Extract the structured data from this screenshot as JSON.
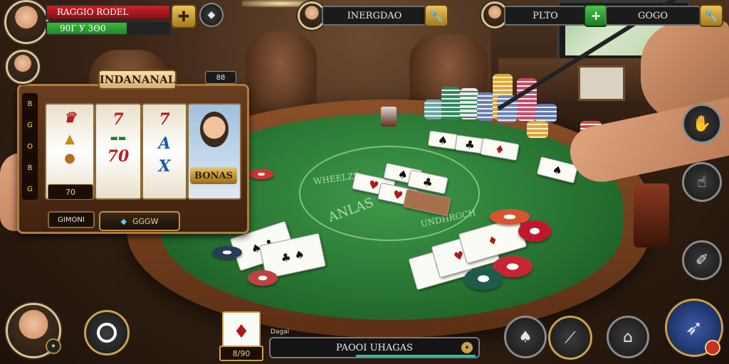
{
  "player_left": {
    "name": "RAGGIO RODEL",
    "chips": "90Г У 3Ѳ0"
  },
  "player_center": {
    "name": "INERGDAO"
  },
  "player_right": {
    "name_left": "PLTO",
    "name_right": "GOGO"
  },
  "slot_machine": {
    "title": "INDANANAL",
    "counter": "88",
    "reel_symbols": [
      "7",
      "7",
      "A",
      "70",
      "X"
    ],
    "bonus_label": "BONAS",
    "reel_value": "70",
    "side_lamps": [
      "B",
      "G",
      "O",
      "B",
      "G"
    ],
    "bottom_left_label": "GIMONI",
    "bottom_right_label": "GGGW"
  },
  "table": {
    "felt_text_left": "WHEELZS",
    "felt_text_center": "ANLAS",
    "felt_text_right": "UNDHRGCH"
  },
  "bottom_bar": {
    "card_label": "8/90",
    "status_prefix": "Dagai",
    "status_text": "PAOOI UHAGAS"
  },
  "icons": {
    "plus": "plus-icon",
    "diamond": "diamond-icon",
    "wrench": "wrench-icon",
    "menu_circle": "ring-icon",
    "action_a": "cards-icon",
    "action_b": "cue-icon",
    "action_c": "house-icon",
    "action_d": "rocket-icon"
  },
  "colors": {
    "felt": "#2f8a3a",
    "gold": "#d4a93a",
    "health_red": "#b8191f",
    "health_green": "#2f9b31"
  }
}
